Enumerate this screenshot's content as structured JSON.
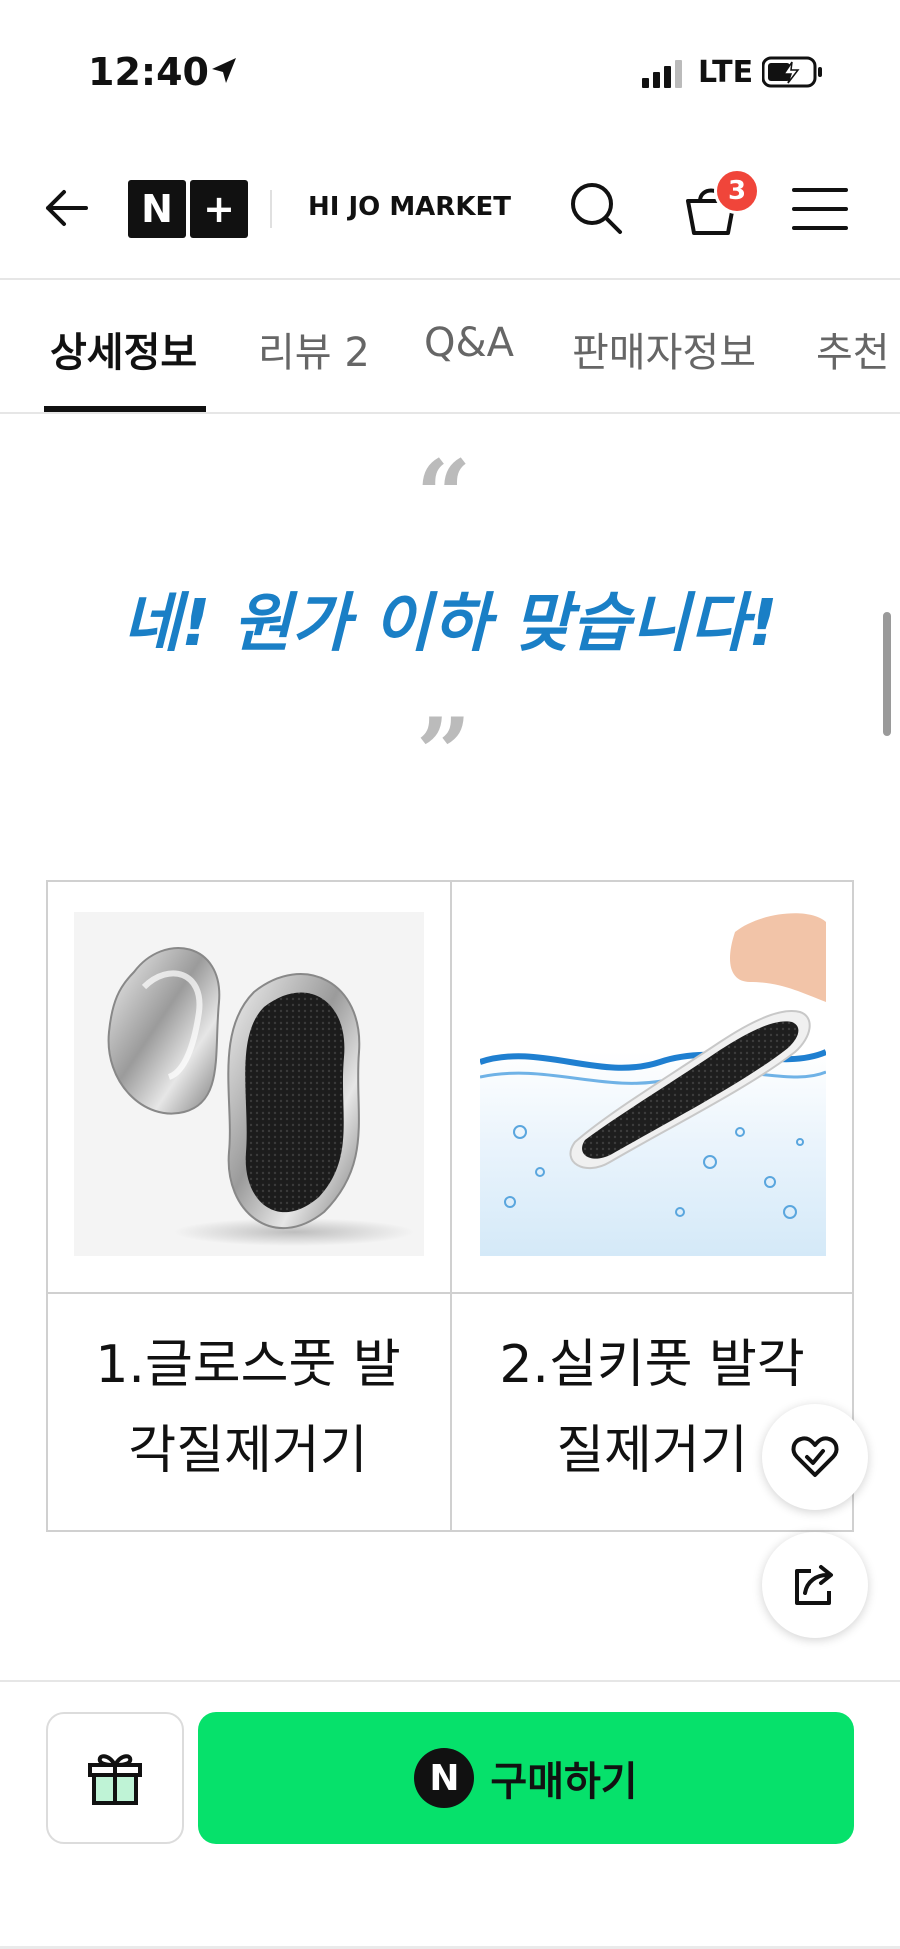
{
  "status_bar": {
    "time": "12:40",
    "network": "LTE"
  },
  "header": {
    "logo_letter_1": "N",
    "logo_letter_2": "+",
    "store_name": "HI JO MARKET",
    "cart_count": "3"
  },
  "tabs": [
    {
      "label": "상세정보",
      "active": true
    },
    {
      "label": "리뷰 2",
      "active": false
    },
    {
      "label": "Q&A",
      "active": false
    },
    {
      "label": "판매자정보",
      "active": false
    },
    {
      "label": "추천",
      "active": false
    }
  ],
  "content": {
    "quote_open": "“",
    "headline": "네! 원가 이하 맞습니다!",
    "quote_close": "”",
    "products": [
      {
        "caption_line1": "1.글로스풋 발",
        "caption_line2": "각질제거기"
      },
      {
        "caption_line1": "2.실키풋 발각",
        "caption_line2": "질제거기"
      }
    ]
  },
  "bottom_bar": {
    "buy_icon_letter": "N",
    "buy_label": "구매하기"
  },
  "colors": {
    "accent_green": "#06e16b",
    "headline_blue": "#1a7fc6",
    "badge_red": "#f0453a"
  },
  "icons": [
    "location-arrow-icon",
    "signal-icon",
    "battery-icon",
    "back-arrow-icon",
    "search-icon",
    "cart-icon",
    "hamburger-menu-icon",
    "heart-check-icon",
    "share-icon",
    "gift-icon"
  ]
}
